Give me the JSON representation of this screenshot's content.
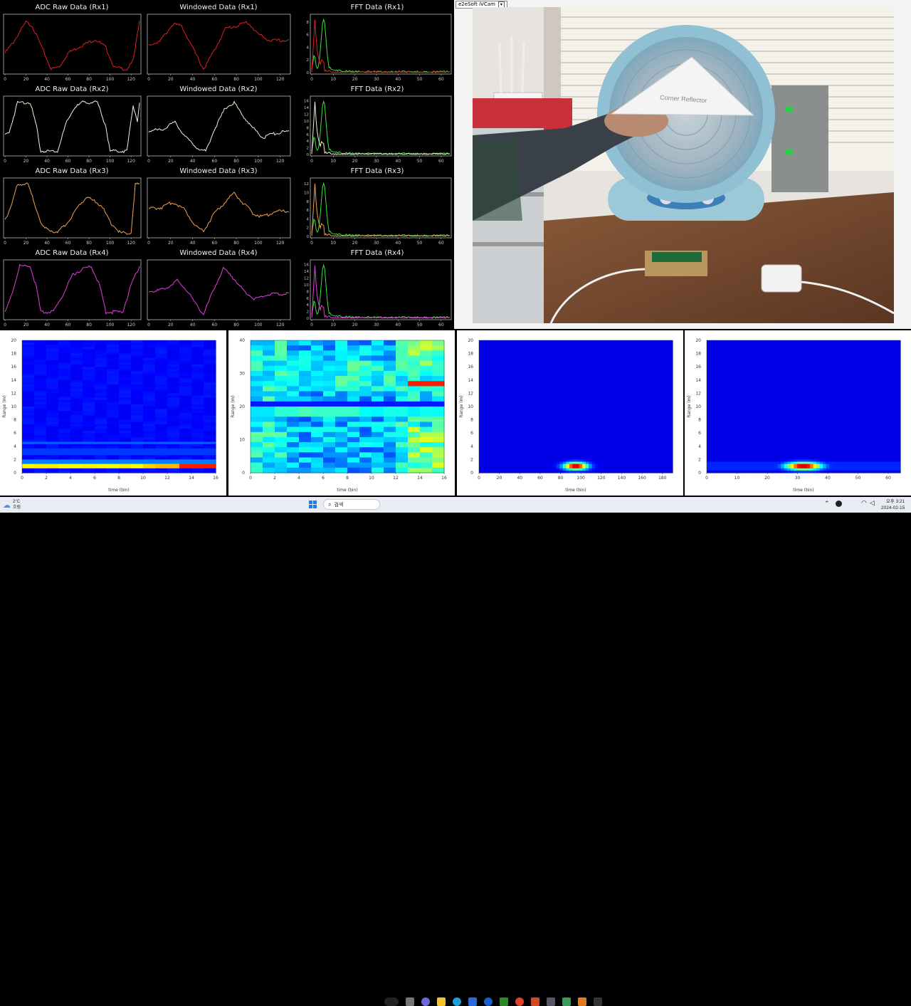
{
  "plots": [
    {
      "title": "ADC Raw Data (Rx1)",
      "kind": "adc",
      "color": "#e02020",
      "xticks": [
        0,
        20,
        40,
        60,
        80,
        100,
        120
      ],
      "yticks": [],
      "profile": "adc1"
    },
    {
      "title": "Windowed Data (Rx1)",
      "kind": "win",
      "color": "#e02020",
      "xticks": [
        0,
        20,
        40,
        60,
        80,
        100,
        120
      ],
      "yticks": [],
      "profile": "win1"
    },
    {
      "title": "FFT Data (Rx1)",
      "kind": "fft",
      "color": "#e02020",
      "xticks": [
        0,
        10,
        20,
        30,
        40,
        50,
        60
      ],
      "yticks": [
        0,
        2,
        4,
        6,
        8
      ],
      "ymax": 9
    },
    {
      "title": "ADC Raw Data (Rx2)",
      "kind": "adc",
      "color": "#f5f0d8",
      "xticks": [
        0,
        20,
        40,
        60,
        80,
        100,
        120
      ],
      "yticks": [],
      "profile": "adc2"
    },
    {
      "title": "Windowed Data (Rx2)",
      "kind": "win",
      "color": "#f5f0d8",
      "xticks": [
        0,
        20,
        40,
        60,
        80,
        100,
        120
      ],
      "yticks": [],
      "profile": "win2"
    },
    {
      "title": "FFT Data (Rx2)",
      "kind": "fft",
      "color": "#f5f0d8",
      "xticks": [
        0,
        10,
        20,
        30,
        40,
        50,
        60
      ],
      "yticks": [
        0,
        2,
        4,
        6,
        8,
        10,
        12,
        14,
        16
      ],
      "ymax": 17
    },
    {
      "title": "ADC Raw Data (Rx3)",
      "kind": "adc",
      "color": "#f0a050",
      "xticks": [
        0,
        20,
        40,
        60,
        80,
        100,
        120
      ],
      "yticks": [],
      "profile": "adc3"
    },
    {
      "title": "Windowed Data (Rx3)",
      "kind": "win",
      "color": "#f0a050",
      "xticks": [
        0,
        20,
        40,
        60,
        80,
        100,
        120
      ],
      "yticks": [],
      "profile": "win3"
    },
    {
      "title": "FFT Data (Rx3)",
      "kind": "fft",
      "color": "#f0a050",
      "xticks": [
        0,
        10,
        20,
        30,
        40,
        50,
        60
      ],
      "yticks": [
        0,
        2,
        4,
        6,
        8,
        10,
        12
      ],
      "ymax": 13
    },
    {
      "title": "ADC Raw Data (Rx4)",
      "kind": "adc",
      "color": "#e040e0",
      "xticks": [
        0,
        20,
        40,
        60,
        80,
        100,
        120
      ],
      "yticks": [],
      "profile": "adc4"
    },
    {
      "title": "Windowed Data (Rx4)",
      "kind": "win",
      "color": "#e040e0",
      "xticks": [
        0,
        20,
        40,
        60,
        80,
        100,
        120
      ],
      "yticks": [],
      "profile": "win4"
    },
    {
      "title": "FFT Data (Rx4)",
      "kind": "fft",
      "color": "#e040e0",
      "xticks": [
        0,
        10,
        20,
        30,
        40,
        50,
        60
      ],
      "yticks": [
        0,
        2,
        4,
        6,
        8,
        10,
        12,
        14,
        16
      ],
      "ymax": 17
    }
  ],
  "fft_second_color": "#40e040",
  "camera": {
    "toolbar_label": "e2eSoft iVCam",
    "reflector_text": "Corner Reflector"
  },
  "chart_data": [
    {
      "type": "heatmap",
      "xlabel": "time (bin)",
      "ylabel": "Range (m)",
      "xticks": [
        0,
        2,
        4,
        6,
        8,
        10,
        12,
        14,
        16
      ],
      "yticks": [
        0,
        2,
        4,
        6,
        8,
        10,
        12,
        14,
        16,
        18,
        20
      ],
      "xlim": [
        0,
        16
      ],
      "ylim": [
        0,
        20
      ],
      "pattern": "range_band_low"
    },
    {
      "type": "heatmap",
      "xlabel": "time (bin)",
      "ylabel": "Range (m)",
      "xticks": [
        0,
        2,
        4,
        6,
        8,
        10,
        12,
        14,
        16
      ],
      "yticks": [
        0,
        10,
        20,
        30,
        40
      ],
      "xlim": [
        0,
        16
      ],
      "ylim": [
        0,
        40
      ],
      "pattern": "noisy"
    },
    {
      "type": "heatmap",
      "xlabel": "time (bin)",
      "ylabel": "Range (m)",
      "xticks": [
        0,
        20,
        40,
        60,
        80,
        100,
        120,
        140,
        160,
        180
      ],
      "yticks": [
        0,
        2,
        4,
        6,
        8,
        10,
        12,
        14,
        16,
        18,
        20
      ],
      "xlim": [
        0,
        190
      ],
      "ylim": [
        0,
        20
      ],
      "pattern": "spot_narrow",
      "spot_x": 95,
      "spot_y": 1
    },
    {
      "type": "heatmap",
      "xlabel": "time (bin)",
      "ylabel": "Range (m)",
      "xticks": [
        0,
        10,
        20,
        30,
        40,
        50,
        60
      ],
      "yticks": [
        0,
        2,
        4,
        6,
        8,
        10,
        12,
        14,
        16,
        18,
        20
      ],
      "xlim": [
        0,
        64
      ],
      "ylim": [
        0,
        20
      ],
      "pattern": "spot_wide",
      "spot_x": 32,
      "spot_y": 1
    }
  ],
  "taskbar": {
    "weather_temp": "2°C",
    "weather_desc": "흐림",
    "search_label": "검색",
    "time": "오후 3:21",
    "date": "2024-02-15"
  }
}
